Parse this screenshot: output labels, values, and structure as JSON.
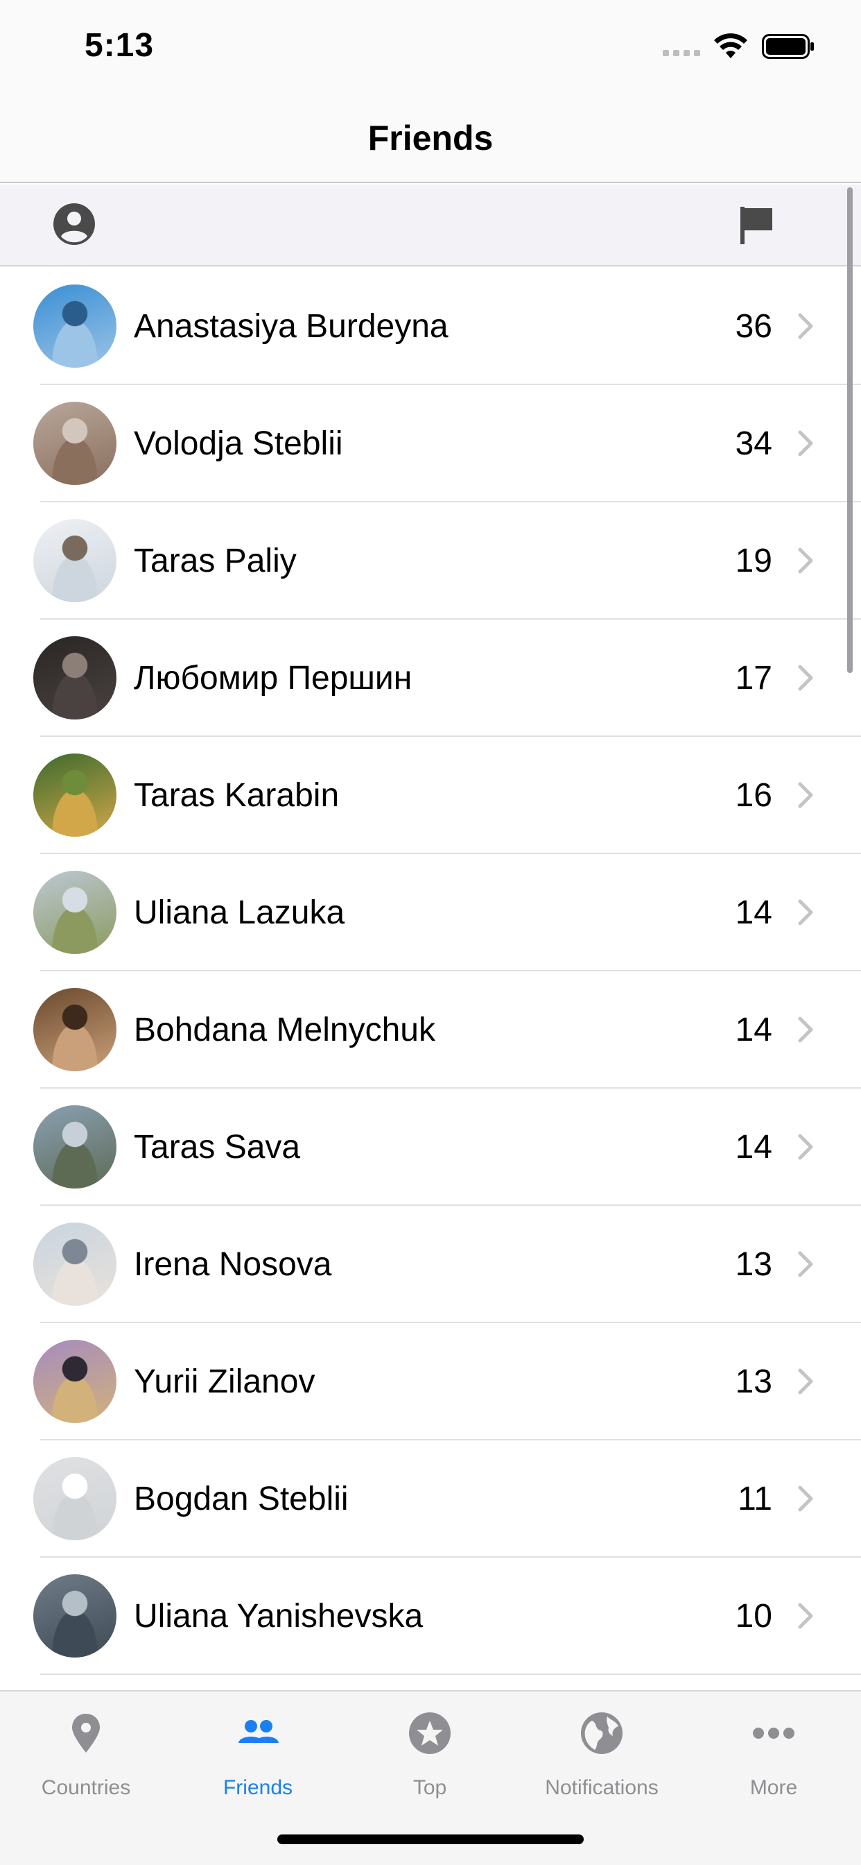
{
  "status_bar": {
    "time": "5:13"
  },
  "nav": {
    "title": "Friends"
  },
  "toolbar": {
    "left_icon": "person-circle-icon",
    "right_icon": "flag-icon"
  },
  "friends": [
    {
      "name": "Anastasiya Burdeyna",
      "count": "36",
      "avatar_colors": [
        "#3a8fd4",
        "#9cc4e6",
        "#2b5d8a"
      ]
    },
    {
      "name": "Volodja Steblii",
      "count": "34",
      "avatar_colors": [
        "#b9a79b",
        "#8a6f5d",
        "#d3c7bd"
      ]
    },
    {
      "name": "Taras Paliy",
      "count": "19",
      "avatar_colors": [
        "#eef1f4",
        "#cdd5de",
        "#7a6a5e"
      ]
    },
    {
      "name": "Любомир Першин",
      "count": "17",
      "avatar_colors": [
        "#2a2624",
        "#4a4240",
        "#8b7f78"
      ]
    },
    {
      "name": "Taras Karabin",
      "count": "16",
      "avatar_colors": [
        "#3d6b2d",
        "#d2a74a",
        "#6e8d3a"
      ]
    },
    {
      "name": "Uliana Lazuka",
      "count": "14",
      "avatar_colors": [
        "#bcc8d3",
        "#8c9a5f",
        "#d6dde4"
      ]
    },
    {
      "name": "Bohdana Melnychuk",
      "count": "14",
      "avatar_colors": [
        "#6b4a2e",
        "#caa07a",
        "#3d2a1c"
      ]
    },
    {
      "name": "Taras Sava",
      "count": "14",
      "avatar_colors": [
        "#8aa0b3",
        "#5d6b55",
        "#c7d0d8"
      ]
    },
    {
      "name": "Irena Nosova",
      "count": "13",
      "avatar_colors": [
        "#c9d4de",
        "#e9e2dc",
        "#7e8894"
      ]
    },
    {
      "name": "Yurii Zilanov",
      "count": "13",
      "avatar_colors": [
        "#a58cbf",
        "#d3b17a",
        "#2d2a33"
      ]
    },
    {
      "name": "Bogdan Steblii",
      "count": "11",
      "avatar_colors": [
        "#dfe1e3",
        "#d0d3d6",
        "#ffffff"
      ]
    },
    {
      "name": "Uliana Yanishevska",
      "count": "10",
      "avatar_colors": [
        "#6f7c87",
        "#3e4a55",
        "#b5bfc7"
      ]
    },
    {
      "name": "",
      "count": "",
      "avatar_colors": [
        "#c7c2bd",
        "#a49d96",
        "#e3dfdb"
      ]
    }
  ],
  "tabs": [
    {
      "label": "Countries",
      "icon": "map-pin-icon",
      "active": false
    },
    {
      "label": "Friends",
      "icon": "people-icon",
      "active": true
    },
    {
      "label": "Top",
      "icon": "star-circle-icon",
      "active": false
    },
    {
      "label": "Notifications",
      "icon": "globe-icon",
      "active": false
    },
    {
      "label": "More",
      "icon": "more-dots-icon",
      "active": false
    }
  ],
  "colors": {
    "accent": "#1a7ff0",
    "inactive": "#8e8e93",
    "chevron": "#c4c4c7",
    "icon": "#4a4a4a"
  }
}
